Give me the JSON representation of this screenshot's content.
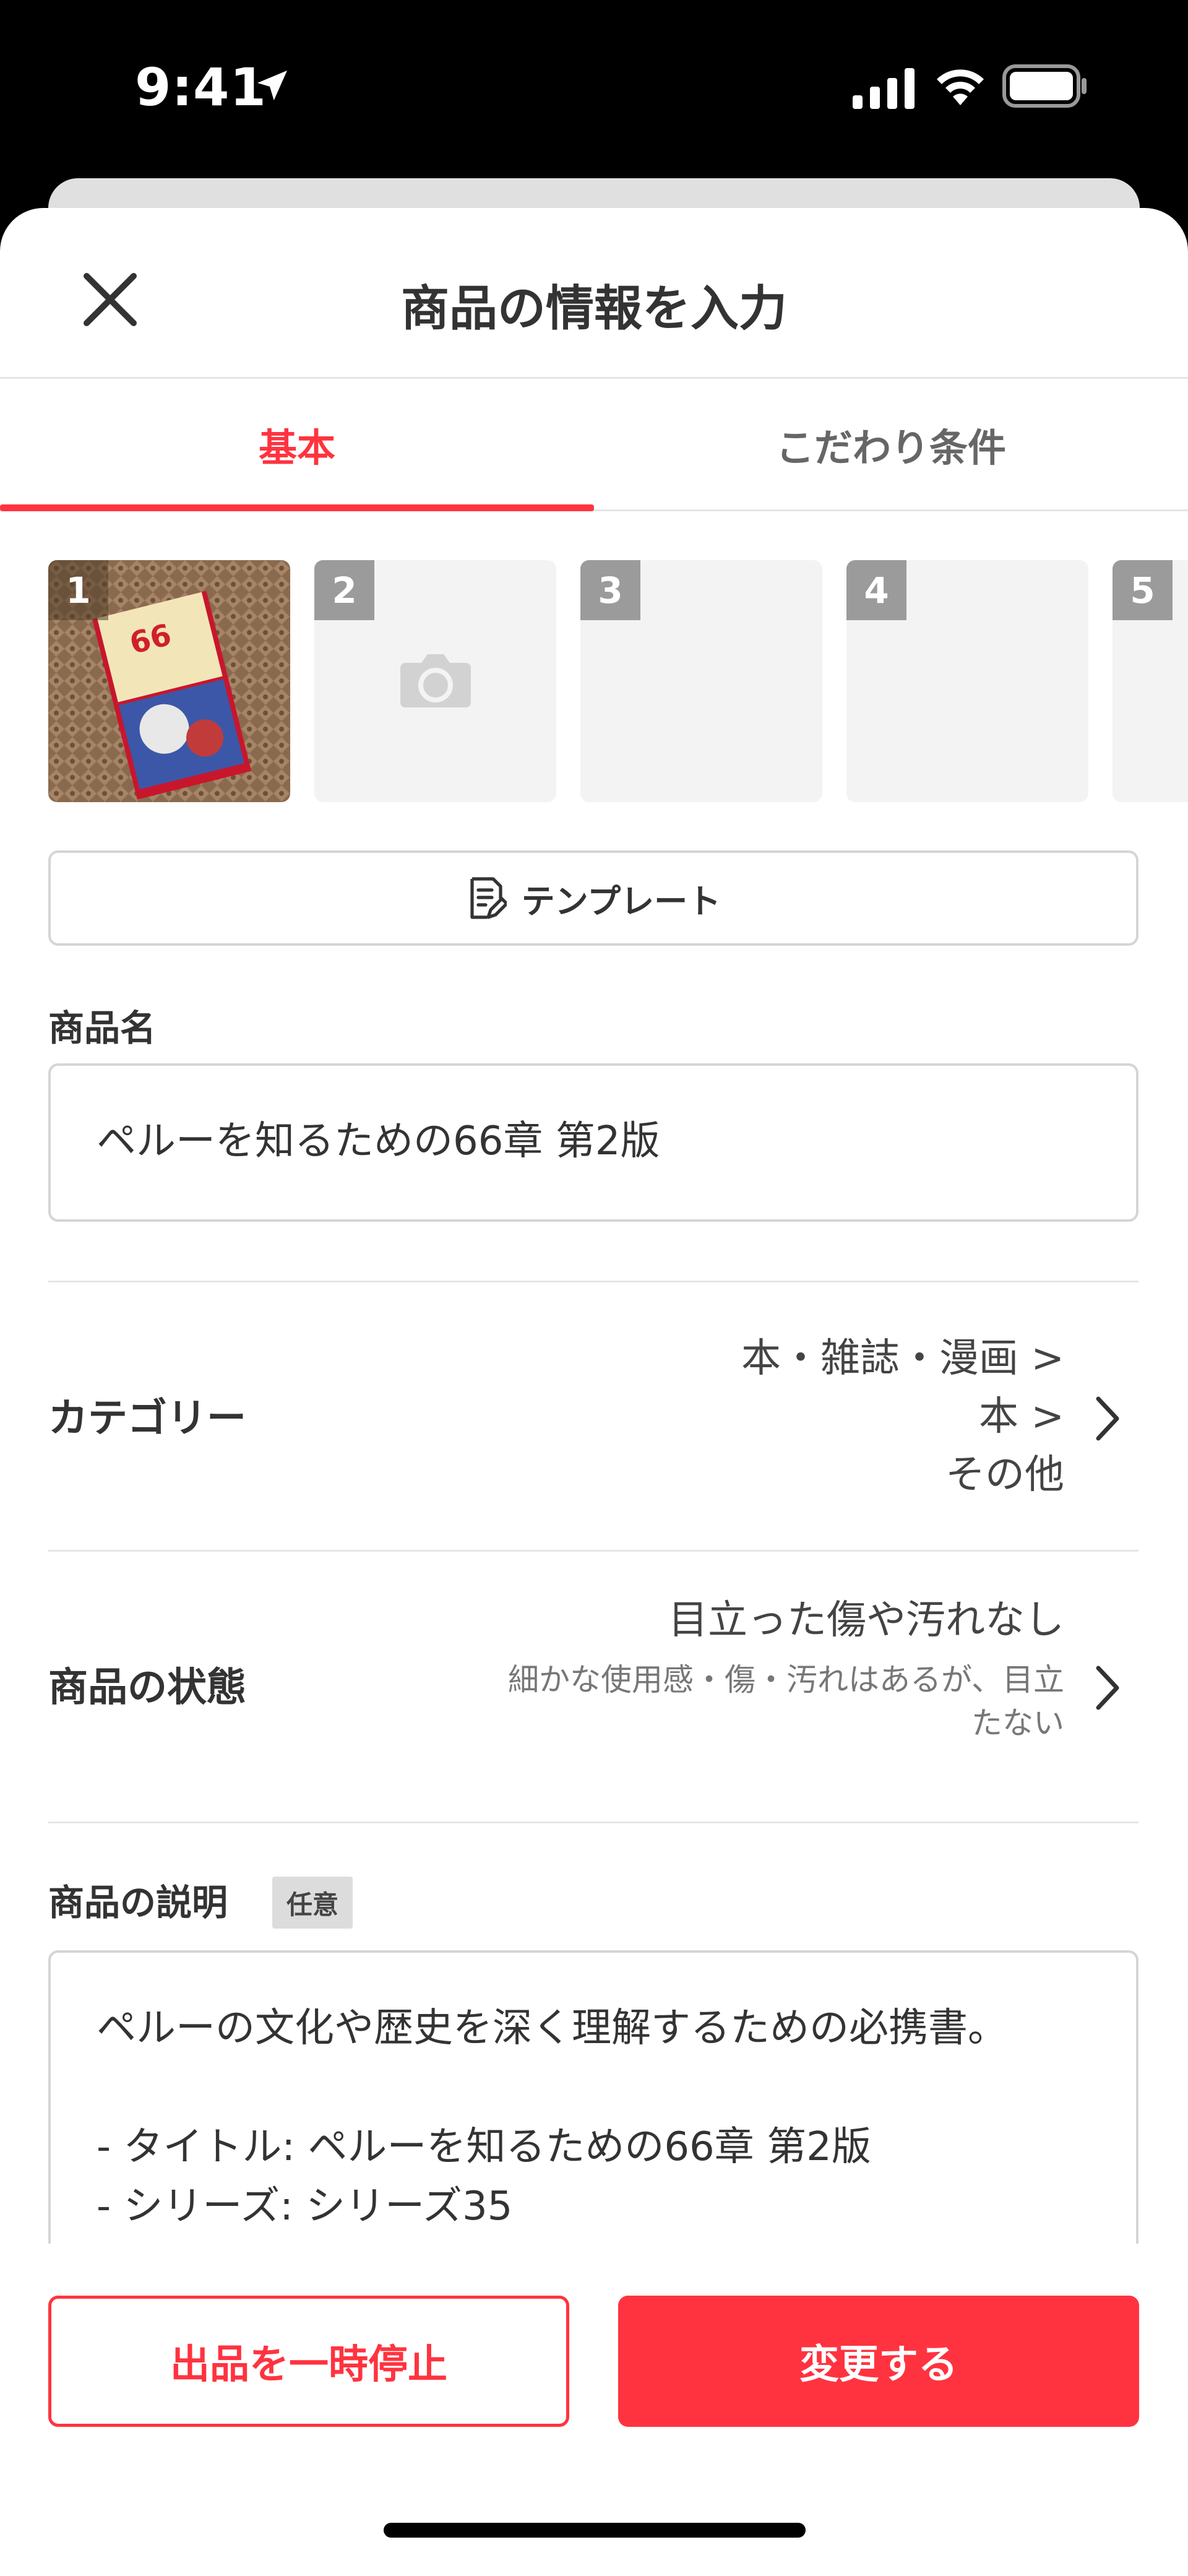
{
  "status_bar": {
    "time": "9:41"
  },
  "header": {
    "title": "商品の情報を入力"
  },
  "tabs": [
    {
      "label": "基本",
      "active": true
    },
    {
      "label": "こだわり条件",
      "active": false
    }
  ],
  "photos": [
    {
      "number": "1",
      "has_image": true
    },
    {
      "number": "2",
      "has_image": false,
      "icon": "camera-icon"
    },
    {
      "number": "3",
      "has_image": false
    },
    {
      "number": "4",
      "has_image": false
    },
    {
      "number": "5",
      "has_image": false
    }
  ],
  "template_button": {
    "label": "テンプレート",
    "icon": "template-icon"
  },
  "product_name": {
    "label": "商品名",
    "value": "ペルーを知るための66章 第2版"
  },
  "category": {
    "label": "カテゴリー",
    "path": [
      "本・雑誌・漫画 >",
      "本 >",
      "その他"
    ]
  },
  "condition": {
    "label": "商品の状態",
    "value": "目立った傷や汚れなし",
    "description": "細かな使用感・傷・汚れはあるが、目立たない"
  },
  "description": {
    "label": "商品の説明",
    "badge": "任意",
    "lines": [
      "ペルーの文化や歴史を深く理解するための必携書。",
      "",
      "- タイトル: ペルーを知るための66章 第2版",
      "- シリーズ: シリーズ35"
    ]
  },
  "actions": {
    "pause_label": "出品を一時停止",
    "save_label": "変更する"
  },
  "colors": {
    "accent": "#ff333f",
    "border": "#d5d5d5",
    "text": "#333333"
  }
}
